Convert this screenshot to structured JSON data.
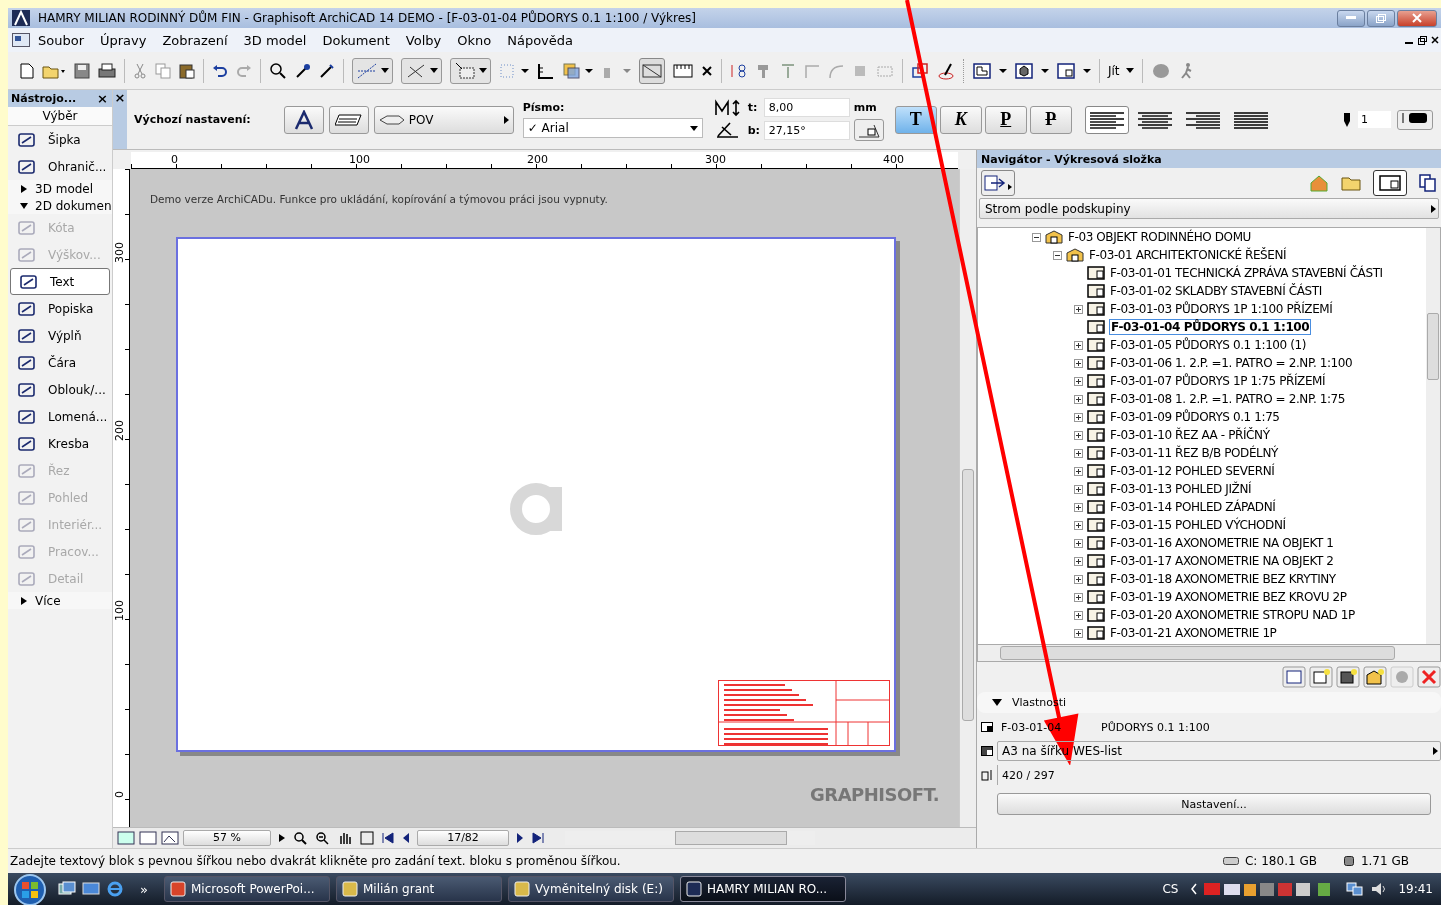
{
  "window": {
    "title": "HAMRY MILIAN RODINNÝ DŮM FIN - Graphisoft ArchiCAD 14 DEMO - [F-03-01-04 PŮDORYS 0.1 1:100 / Výkres]"
  },
  "menu": [
    "Soubor",
    "Úpravy",
    "Zobrazení",
    "3D model",
    "Dokument",
    "Volby",
    "Okno",
    "Nápověda"
  ],
  "toolbar": {
    "goto_label": "Jít"
  },
  "toolbox": {
    "title": "Nástrojo...",
    "close": "×",
    "selection_tab": "Výběr",
    "items": [
      {
        "kind": "tool",
        "label": "Šipka",
        "disabled": false,
        "selected": false
      },
      {
        "kind": "tool",
        "label": "Ohranič...",
        "disabled": false,
        "selected": false
      },
      {
        "kind": "group",
        "label": "3D model",
        "expanded": false
      },
      {
        "kind": "group",
        "label": "2D dokumen",
        "expanded": true
      },
      {
        "kind": "tool",
        "label": "Kóta",
        "disabled": true,
        "selected": false
      },
      {
        "kind": "tool",
        "label": "Výškov...",
        "disabled": true,
        "selected": false
      },
      {
        "kind": "tool",
        "label": "Text",
        "disabled": false,
        "selected": true
      },
      {
        "kind": "tool",
        "label": "Popiska",
        "disabled": false,
        "selected": false
      },
      {
        "kind": "tool",
        "label": "Výplň",
        "disabled": false,
        "selected": false
      },
      {
        "kind": "tool",
        "label": "Čára",
        "disabled": false,
        "selected": false
      },
      {
        "kind": "tool",
        "label": "Oblouk/...",
        "disabled": false,
        "selected": false
      },
      {
        "kind": "tool",
        "label": "Lomená...",
        "disabled": false,
        "selected": false
      },
      {
        "kind": "tool",
        "label": "Kresba",
        "disabled": false,
        "selected": false
      },
      {
        "kind": "tool",
        "label": "Řez",
        "disabled": true,
        "selected": false
      },
      {
        "kind": "tool",
        "label": "Pohled",
        "disabled": true,
        "selected": false
      },
      {
        "kind": "tool",
        "label": "Interiér...",
        "disabled": true,
        "selected": false
      },
      {
        "kind": "tool",
        "label": "Pracov...",
        "disabled": true,
        "selected": false
      },
      {
        "kind": "tool",
        "label": "Detail",
        "disabled": true,
        "selected": false
      },
      {
        "kind": "group",
        "label": "Více",
        "expanded": false
      }
    ]
  },
  "info_box": {
    "close": "×",
    "default_label": "Výchozí nastavení:",
    "layer": "POV",
    "font_label": "Písmo:",
    "font": "✓ Arial",
    "size_label": "t:",
    "size_value": "8,00",
    "unit": "mm",
    "angle_label": "b:",
    "angle_value": "27,15°",
    "styles": [
      {
        "label": "T",
        "selected": true
      },
      {
        "label": "K",
        "selected": false
      },
      {
        "label": "P",
        "selected": false
      },
      {
        "label": "P",
        "selected": false
      }
    ],
    "alignments": [
      {
        "selected": true
      },
      {
        "selected": false
      },
      {
        "selected": false
      },
      {
        "selected": false
      }
    ],
    "pen": "1"
  },
  "canvas": {
    "notice": "Demo verze ArchiCADu. Funkce pro ukládání, kopírování a týmovou práci jsou vypnuty.",
    "top_ruler": [
      "0",
      "100",
      "200",
      "300",
      "400"
    ],
    "left_ruler": [
      "300",
      "200",
      "100",
      "0"
    ],
    "logo": "GRAPHISOFT.",
    "zoom": "57 %",
    "page": "17/82"
  },
  "navigator": {
    "title": "Navigátor - Výkresová složka",
    "view_mode": "Strom podle podskupiny",
    "tree": [
      {
        "label": "F-03 OBJEKT RODINNÉHO  DOMU",
        "kind": "folder",
        "expanded": true,
        "children": [
          {
            "label": "F-03-01 ARCHITEKTONICKÉ ŘEŠENÍ",
            "kind": "folder",
            "expanded": true,
            "children": [
              {
                "label": "F-03-01-01 TECHNICKÁ ZPRÁVA STAVEBNÍ ČÁSTI",
                "kind": "layout",
                "has_children": false,
                "selected": false
              },
              {
                "label": "F-03-01-02 SKLADBY  STAVEBNÍ ČÁSTI",
                "kind": "layout",
                "has_children": false,
                "selected": false
              },
              {
                "label": "F-03-01-03 PŮDORYS  1P  1:100 PŘÍZEMÍ",
                "kind": "layout",
                "expanded": false,
                "has_children": true,
                "selected": false
              },
              {
                "label": "F-03-01-04 PŮDORYS 0.1 1:100",
                "kind": "layout",
                "has_children": false,
                "selected": true
              },
              {
                "label": "F-03-01-05 PŮDORYS 0.1 1:100 (1)",
                "kind": "layout",
                "expanded": false,
                "has_children": true,
                "selected": false
              },
              {
                "label": "F-03-01-06 1. 2.P. =1. PATRO = 2.NP. 1:100",
                "kind": "layout",
                "expanded": false,
                "has_children": true,
                "selected": false
              },
              {
                "label": "F-03-01-07 PŮDORYS  1P  1:75 PŘÍZEMÍ",
                "kind": "layout",
                "expanded": false,
                "has_children": true,
                "selected": false
              },
              {
                "label": "F-03-01-08 1. 2.P. =1. PATRO = 2.NP. 1:75",
                "kind": "layout",
                "expanded": false,
                "has_children": true,
                "selected": false
              },
              {
                "label": "F-03-01-09 PŮDORYS 0.1    1:75",
                "kind": "layout",
                "expanded": false,
                "has_children": true,
                "selected": false
              },
              {
                "label": "F-03-01-10 ŘEZ  AA - PŘÍČNÝ",
                "kind": "layout",
                "expanded": false,
                "has_children": true,
                "selected": false
              },
              {
                "label": "F-03-01-11 ŘEZ B/B PODÉLNÝ",
                "kind": "layout",
                "expanded": false,
                "has_children": true,
                "selected": false
              },
              {
                "label": "F-03-01-12 POHLED SEVERNÍ",
                "kind": "layout",
                "expanded": false,
                "has_children": true,
                "selected": false
              },
              {
                "label": "F-03-01-13 POHLED JIŽNÍ",
                "kind": "layout",
                "expanded": false,
                "has_children": true,
                "selected": false
              },
              {
                "label": "F-03-01-14 POHLED ZÁPADNÍ",
                "kind": "layout",
                "expanded": false,
                "has_children": true,
                "selected": false
              },
              {
                "label": "F-03-01-15 POHLED VÝCHODNÍ",
                "kind": "layout",
                "expanded": false,
                "has_children": true,
                "selected": false
              },
              {
                "label": "F-03-01-16 AXONOMETRIE NA OBJEKT 1",
                "kind": "layout",
                "expanded": false,
                "has_children": true,
                "selected": false
              },
              {
                "label": "F-03-01-17 AXONOMETRIE NA OBJEKT 2",
                "kind": "layout",
                "expanded": false,
                "has_children": true,
                "selected": false
              },
              {
                "label": "F-03-01-18 AXONOMETRIE BEZ KRYTINY",
                "kind": "layout",
                "expanded": false,
                "has_children": true,
                "selected": false
              },
              {
                "label": "F-03-01-19 AXONOMETRIE BEZ KROVU 2P",
                "kind": "layout",
                "expanded": false,
                "has_children": true,
                "selected": false
              },
              {
                "label": "F-03-01-20 AXONOMETRIE STROPU NAD 1P",
                "kind": "layout",
                "expanded": false,
                "has_children": true,
                "selected": false
              },
              {
                "label": "F-03-01-21 AXONOMETRIE 1P",
                "kind": "layout",
                "expanded": false,
                "has_children": true,
                "selected": false
              }
            ]
          }
        ]
      }
    ],
    "properties": {
      "heading": "Vlastnosti",
      "expanded": true,
      "id": "F-03-01-04",
      "name": "PŮDORYS 0.1 1:100",
      "master": "A3 na šířku WES-list",
      "size": "420 / 297",
      "settings_button": "Nastavení..."
    }
  },
  "status_bar": {
    "message": "Zadejte textový blok s pevnou šířkou nebo dvakrát klikněte pro zadání text. bloku s proměnou šířkou.",
    "disk": "C: 180.1 GB",
    "memory": "1.71 GB"
  },
  "taskbar": {
    "items": [
      {
        "label": "Microsoft PowerPoi...",
        "selected": false
      },
      {
        "label": "Milián grant",
        "selected": false
      },
      {
        "label": "Vyměnitelný disk (E:)",
        "selected": false
      },
      {
        "label": "HAMRY MILIAN RO...",
        "selected": true
      }
    ],
    "more": "»",
    "language": "CS",
    "time": "19:41"
  }
}
